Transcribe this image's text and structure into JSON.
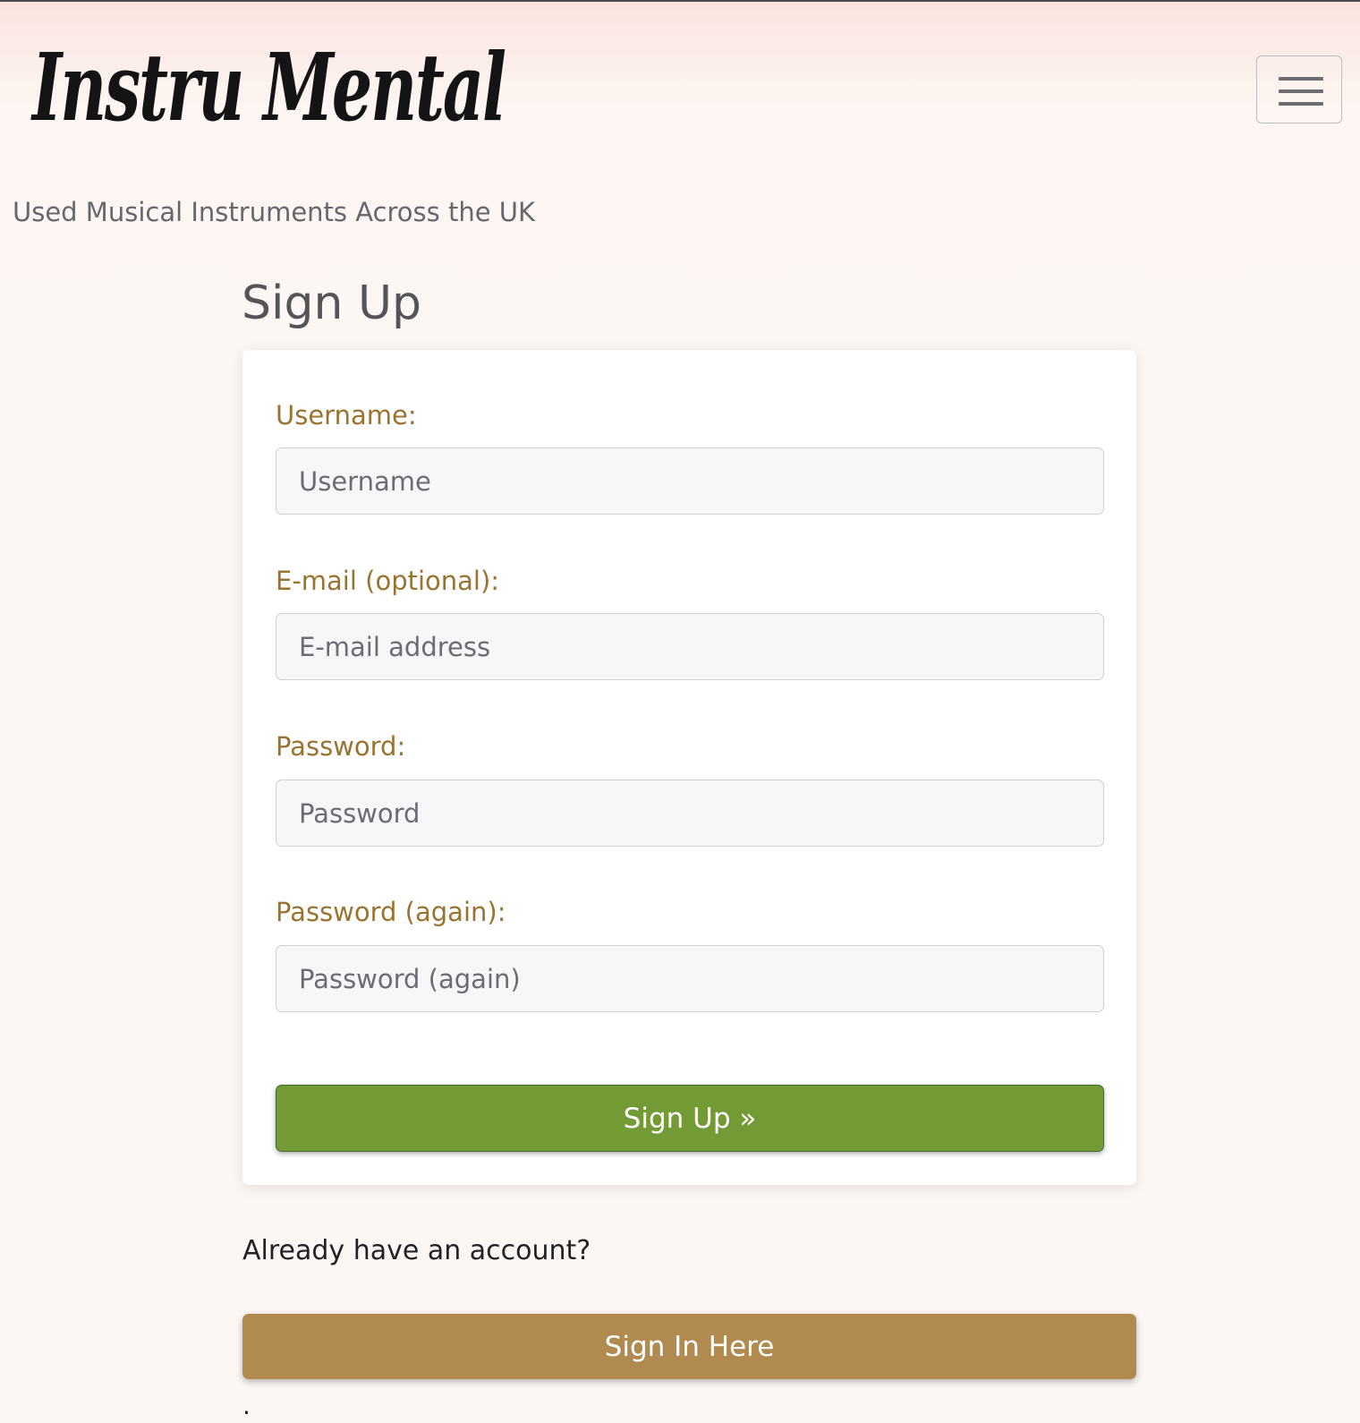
{
  "site": {
    "logo_text": "Instru Mental",
    "tagline": "Used Musical Instruments Across the UK"
  },
  "header": {
    "menu_icon": "hamburger-menu-icon"
  },
  "page": {
    "title": "Sign Up"
  },
  "form": {
    "fields": [
      {
        "label": "Username:",
        "placeholder": "Username",
        "type": "text"
      },
      {
        "label": "E-mail (optional):",
        "placeholder": "E-mail address",
        "type": "email"
      },
      {
        "label": "Password:",
        "placeholder": "Password",
        "type": "password"
      },
      {
        "label": "Password (again):",
        "placeholder": "Password (again)",
        "type": "password"
      }
    ],
    "submit_label": "Sign Up »"
  },
  "signin": {
    "prompt": "Already have an account?",
    "button_label": "Sign In Here"
  },
  "footer": {
    "text": "."
  },
  "colors": {
    "label": "#9a7330",
    "primary_button": "#739a35",
    "secondary_button": "#b08a4f"
  }
}
